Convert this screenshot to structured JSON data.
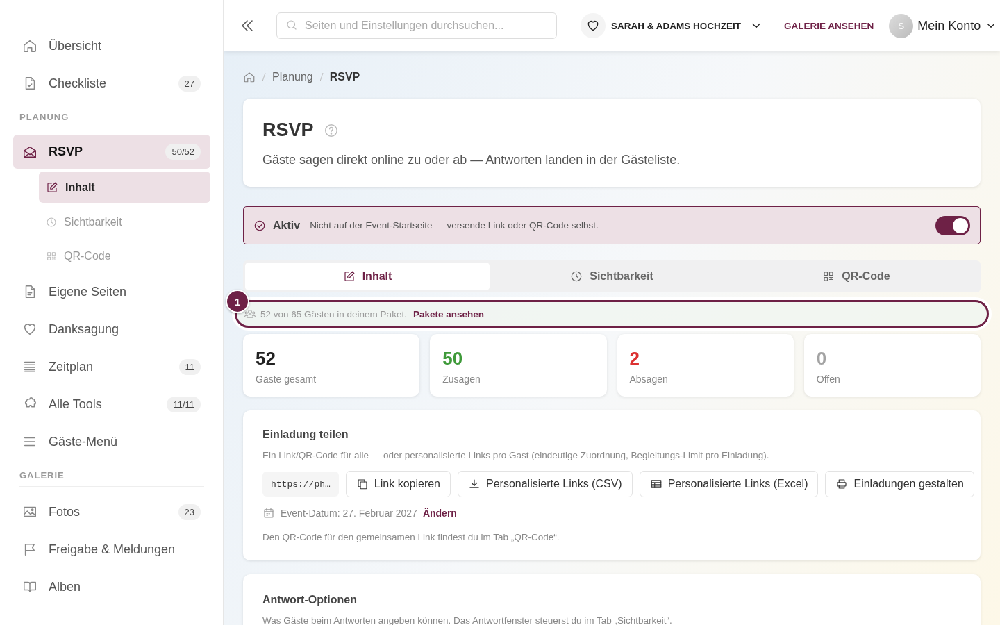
{
  "sidebar": {
    "groups": [
      {
        "items": [
          {
            "label": "Übersicht",
            "selected": false
          },
          {
            "label": "Checkliste",
            "badge": "27",
            "selected": false
          }
        ]
      },
      {
        "heading": "PLANUNG",
        "items": [
          {
            "label": "RSVP",
            "badge": "50/52",
            "selected": true,
            "children": [
              {
                "label": "Inhalt",
                "selected": true
              },
              {
                "label": "Sichtbarkeit",
                "selected": false
              },
              {
                "label": "QR-Code",
                "selected": false
              }
            ]
          },
          {
            "label": "Eigene Seiten",
            "selected": false
          },
          {
            "label": "Danksagung",
            "selected": false
          },
          {
            "label": "Zeitplan",
            "badge": "11",
            "selected": false
          },
          {
            "label": "Alle Tools",
            "badge": "11/11",
            "selected": false
          },
          {
            "label": "Gäste-Menü",
            "selected": false
          }
        ]
      },
      {
        "heading": "GALERIE",
        "items": [
          {
            "label": "Fotos",
            "badge": "23",
            "selected": false
          },
          {
            "label": "Freigabe & Meldungen",
            "selected": false
          },
          {
            "label": "Alben",
            "selected": false
          }
        ]
      }
    ]
  },
  "topbar": {
    "search": {
      "placeholder": "Seiten und Einstellungen durchsuchen..."
    },
    "event": "SARAH & ADAMS HOCHZEIT",
    "gallery_link": "GALERIE ANSEHEN",
    "avatar": "S",
    "account": "Mein Konto"
  },
  "breadcrumb": [
    "Planung",
    "RSVP"
  ],
  "header": {
    "title": "RSVP",
    "subtitle": "Gäste sagen direkt online zu oder ab — Antworten landen in der Gästeliste."
  },
  "status": {
    "label": "Aktiv",
    "text": "Nicht auf der Event-Startseite — versende Link oder QR-Code selbst.",
    "on": true
  },
  "tabs": [
    {
      "label": "Inhalt",
      "selected": true
    },
    {
      "label": "Sichtbarkeit",
      "selected": false
    },
    {
      "label": "QR-Code",
      "selected": false
    }
  ],
  "notice": {
    "step": "1",
    "text": "52 von 65 Gästen in deinem Paket.",
    "link": "Pakete ansehen"
  },
  "stats": [
    {
      "value": "52",
      "label": "Gäste gesamt",
      "color": "#222222"
    },
    {
      "value": "50",
      "label": "Zusagen",
      "color": "#3f9a3a"
    },
    {
      "value": "2",
      "label": "Absagen",
      "color": "#dc3232"
    },
    {
      "value": "0",
      "label": "Offen",
      "color": "#a3a3a3"
    }
  ],
  "share": {
    "title": "Einladung teilen",
    "description": "Ein Link/QR-Code für alle — oder personalisierte Links pro Gast (eindeutige Zuordnung, Begleitungs-Limit pro Einladung).",
    "url": "https://ph…",
    "buttons": [
      "Link kopieren",
      "Personalisierte Links (CSV)",
      "Personalisierte Links (Excel)",
      "Einladungen gestalten"
    ],
    "date": "Event-Datum: 27. Februar 2027",
    "date_link": "Ändern",
    "note": "Den QR-Code für den gemeinsamen Link findest du im Tab „QR-Code“."
  },
  "options": {
    "title": "Antwort-Optionen",
    "description": "Was Gäste beim Antworten angeben können. Das Antwortfenster steuerst du im Tab „Sichtbarkeit“."
  }
}
